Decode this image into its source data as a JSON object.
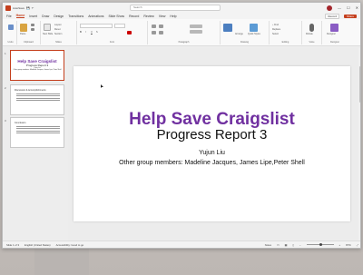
{
  "window": {
    "app_icon": "powerpoint-logo",
    "autosave_label": "AutoSave",
    "doc_title": "Help Save Craigslist - Progress Report 3",
    "search_placeholder": "Search",
    "user_initial": "Y",
    "controls": {
      "minimize": "—",
      "maximize": "☐",
      "close": "✕"
    }
  },
  "menu": {
    "tabs": [
      "File",
      "Home",
      "Insert",
      "Draw",
      "Design",
      "Transitions",
      "Animations",
      "Slide Show",
      "Record",
      "Review",
      "View",
      "Help"
    ],
    "active_tab": "Home",
    "record_label": "Record",
    "share_label": "Share"
  },
  "ribbon": {
    "groups": [
      {
        "label": "Undo"
      },
      {
        "label": "Clipboard"
      },
      {
        "label": "Slides"
      },
      {
        "label": "Font"
      },
      {
        "label": "Paragraph"
      },
      {
        "label": "Drawing"
      },
      {
        "label": "Editing"
      },
      {
        "label": "Voice"
      },
      {
        "label": "Designer"
      }
    ],
    "clipboard": {
      "paste": "Paste"
    },
    "slides": {
      "new_slide": "New Slide",
      "layout": "Layout",
      "reset": "Reset",
      "section": "Section"
    },
    "drawing": {
      "arrange": "Arrange",
      "quick_styles": "Quick Styles"
    },
    "editing": {
      "find": "Find",
      "replace": "Replace",
      "select": "Select"
    },
    "voice": {
      "dictate": "Dictate"
    },
    "designer": {
      "designer": "Designer"
    }
  },
  "thumbnails": [
    {
      "number": "1",
      "title": "Help Save Craigslist",
      "subtitle": "Progress Report 3",
      "author": "Yujun Liu",
      "members": "Other group members: Madeline Jacques, James Lipe, Peter Shell",
      "selected": true
    },
    {
      "number": "2",
      "heading": "Discussion & Accomplishments"
    },
    {
      "number": "3",
      "heading": "Conclusion"
    }
  ],
  "slide": {
    "title": "Help Save Craigslist",
    "subtitle": "Progress Report 3",
    "author": "Yujun Liu",
    "members": "Other group members: Madeline Jacques, James Lipe,Peter Shell"
  },
  "status": {
    "slide_counter": "Slide 1 of 3",
    "language": "English (United States)",
    "accessibility": "Accessibility: Good to go",
    "notes": "Notes",
    "zoom": "87%"
  },
  "colors": {
    "accent": "#c43e1c",
    "title_purple": "#7030a0"
  }
}
